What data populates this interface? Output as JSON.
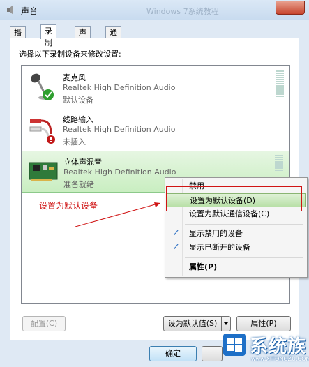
{
  "window": {
    "title": "声音",
    "background_title": "Windows 7系统教程"
  },
  "tabs": [
    {
      "label": "播放",
      "active": false
    },
    {
      "label": "录制",
      "active": true
    },
    {
      "label": "声音",
      "active": false
    },
    {
      "label": "通信",
      "active": false
    }
  ],
  "instruction": "选择以下录制设备来修改设置:",
  "devices": [
    {
      "name": "麦克风",
      "driver": "Realtek High Definition Audio",
      "status": "默认设备",
      "icon": "microphone-icon"
    },
    {
      "name": "线路输入",
      "driver": "Realtek High Definition Audio",
      "status": "未插入",
      "icon": "line-in-jack-icon"
    },
    {
      "name": "立体声混音",
      "driver": "Realtek High Definition Audio",
      "status": "准备就绪",
      "icon": "sound-card-icon",
      "selected": true
    }
  ],
  "context_menu": {
    "items": [
      {
        "label": "禁用",
        "checked": false
      },
      {
        "label": "设置为默认设备(D)",
        "checked": false,
        "highlighted": true
      },
      {
        "label": "设置为默认通信设备(C)",
        "checked": false
      },
      {
        "label": "显示禁用的设备",
        "checked": true
      },
      {
        "label": "显示已断开的设备",
        "checked": true
      },
      {
        "label": "属性(P)",
        "checked": false,
        "bold": true
      }
    ]
  },
  "annotation": "设置为默认设备",
  "buttons": {
    "configure": "配置(C)",
    "set_default": "设为默认值(S)",
    "properties": "属性(P)",
    "ok": "确定"
  },
  "watermark": {
    "text": "系统族",
    "url": "www.XITONGZU.COM"
  },
  "colors": {
    "accent_red": "#d01414",
    "selection_green": "#c9eec1"
  }
}
